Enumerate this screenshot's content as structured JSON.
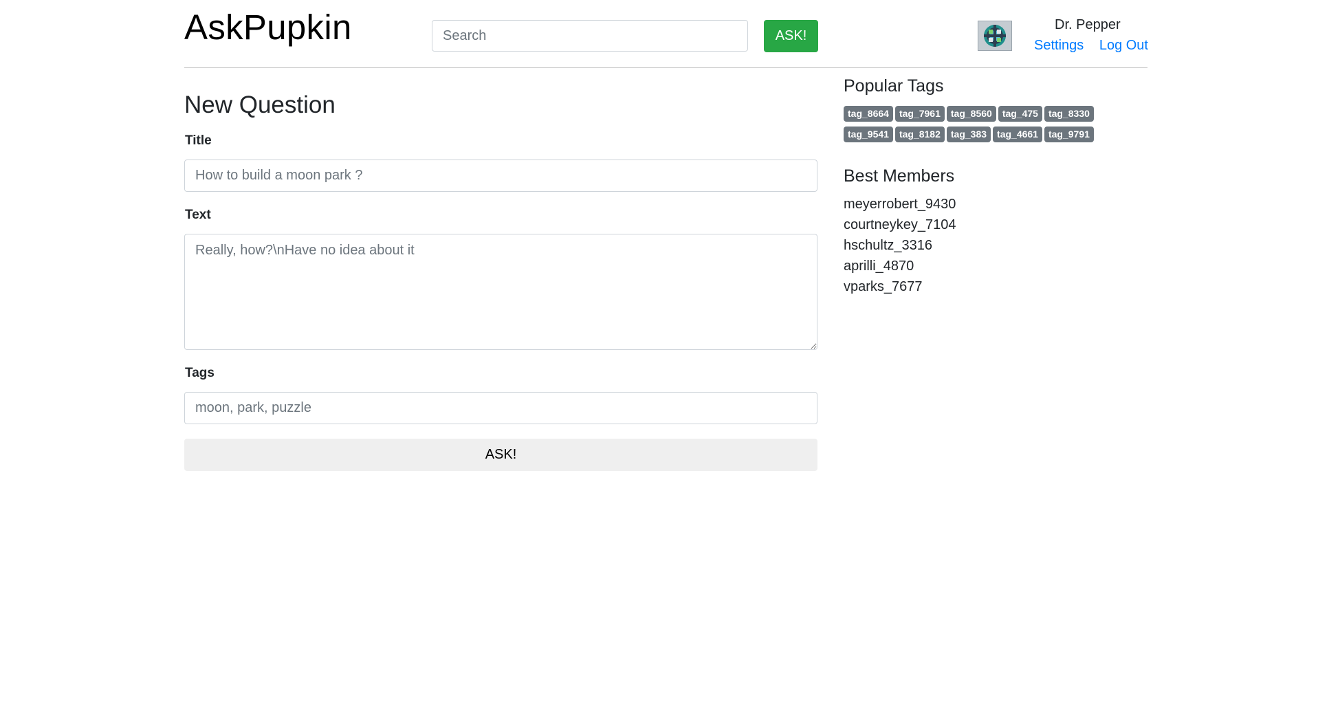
{
  "header": {
    "logo": "AskPupkin",
    "search_placeholder": "Search",
    "ask_label": "ASK!",
    "user_name": "Dr. Pepper",
    "settings_label": "Settings",
    "logout_label": "Log Out"
  },
  "main": {
    "page_title": "New Question",
    "title_label": "Title",
    "title_placeholder": "How to build a moon park ?",
    "text_label": "Text",
    "text_placeholder": "Really, how?\\nHave no idea about it",
    "tags_label": "Tags",
    "tags_placeholder": "moon, park, puzzle",
    "submit_label": "ASK!"
  },
  "sidebar": {
    "popular_tags_title": "Popular Tags",
    "tags": [
      "tag_8664",
      "tag_7961",
      "tag_8560",
      "tag_475",
      "tag_8330",
      "tag_9541",
      "tag_8182",
      "tag_383",
      "tag_4661",
      "tag_9791"
    ],
    "best_members_title": "Best Members",
    "members": [
      "meyerrobert_9430",
      "courtneykey_7104",
      "hschultz_3316",
      "aprilli_4870",
      "vparks_7677"
    ]
  },
  "colors": {
    "primary_link": "#007bff",
    "ask_button": "#28a745",
    "tag_badge": "#6c757d"
  }
}
